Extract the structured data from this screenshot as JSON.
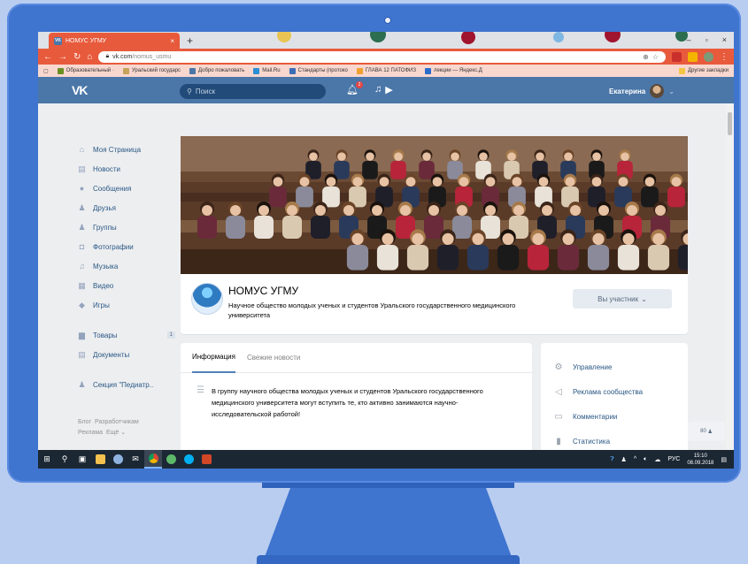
{
  "browser": {
    "tab_title": "НОМУС УГМУ",
    "tab_close": "×",
    "new_tab": "+",
    "window_controls": [
      "–",
      "▫",
      "×"
    ],
    "url_host": "vk.com",
    "url_path": "/nomus_usmu",
    "bookmarks": [
      {
        "label": "Образовательный ·",
        "color": "#6b8e23"
      },
      {
        "label": "Уральский государс",
        "color": "#c7a35a"
      },
      {
        "label": "Добро пожаловать",
        "color": "#4a76a8"
      },
      {
        "label": "Mail.Ru",
        "color": "#2b8fd6"
      },
      {
        "label": "Стандарты (протоко",
        "color": "#3d6db5"
      },
      {
        "label": "ГЛАВА 12 ПАТОФИЗ",
        "color": "#f0a030"
      },
      {
        "label": "лекции — Яндекс.Д",
        "color": "#2a6dcb"
      }
    ],
    "bookmarks_other": "Другие закладки"
  },
  "vk_header": {
    "logo": "VK",
    "search_placeholder": "Поиск",
    "notification_count": "2",
    "user_name": "Екатерина"
  },
  "left_menu": [
    {
      "label": "Моя Страница",
      "icon": "home-icon",
      "glyph": "⌂"
    },
    {
      "label": "Новости",
      "icon": "news-icon",
      "glyph": "▤"
    },
    {
      "label": "Сообщения",
      "icon": "messages-icon",
      "glyph": "●"
    },
    {
      "label": "Друзья",
      "icon": "friends-icon",
      "glyph": "♟"
    },
    {
      "label": "Группы",
      "icon": "groups-icon",
      "glyph": "♟"
    },
    {
      "label": "Фотографии",
      "icon": "photos-icon",
      "glyph": "◘"
    },
    {
      "label": "Музыка",
      "icon": "music-icon",
      "glyph": "♫"
    },
    {
      "label": "Видео",
      "icon": "video-icon",
      "glyph": "▦"
    },
    {
      "label": "Игры",
      "icon": "games-icon",
      "glyph": "◆"
    }
  ],
  "left_menu_extra": [
    {
      "label": "Товары",
      "icon": "goods-icon",
      "glyph": "▆",
      "count": "1"
    },
    {
      "label": "Документы",
      "icon": "documents-icon",
      "glyph": "▤"
    }
  ],
  "left_menu_section": {
    "label": "Секция \"Педиатр..",
    "icon": "section-icon",
    "glyph": "♟"
  },
  "footer_links": [
    "Блог",
    "Разработчикам",
    "Реклама",
    "Ещё ⌄"
  ],
  "group": {
    "name": "НОМУС УГМУ",
    "description": "Научное общество молодых ученых и студентов Уральского государственного медицинского университета",
    "member_button": "Вы участник",
    "member_count": "80"
  },
  "info_tabs": {
    "active": "Информация",
    "inactive": "Свежие новости"
  },
  "info_text": "В группу научного общества молодых ученых и студентов Уральского государственного медицинского университета могут вступить те, кто активно занимаются научно-исследовательской работой!",
  "right_menu": [
    {
      "label": "Управление",
      "icon": "settings-icon",
      "glyph": "⚙"
    },
    {
      "label": "Реклама сообщества",
      "icon": "megaphone-icon",
      "glyph": "◁"
    },
    {
      "label": "Комментарии",
      "icon": "comments-icon",
      "glyph": "▭"
    },
    {
      "label": "Статистика",
      "icon": "statistics-icon",
      "glyph": "▮"
    }
  ],
  "taskbar": {
    "language": "РУС",
    "time": "15:10",
    "date": "08.09.2018"
  },
  "colors": {
    "accent_orange": "#e85a3c",
    "vk_blue": "#4a76a8",
    "monitor": "#3f74cf",
    "background": "#b9cdf0"
  }
}
